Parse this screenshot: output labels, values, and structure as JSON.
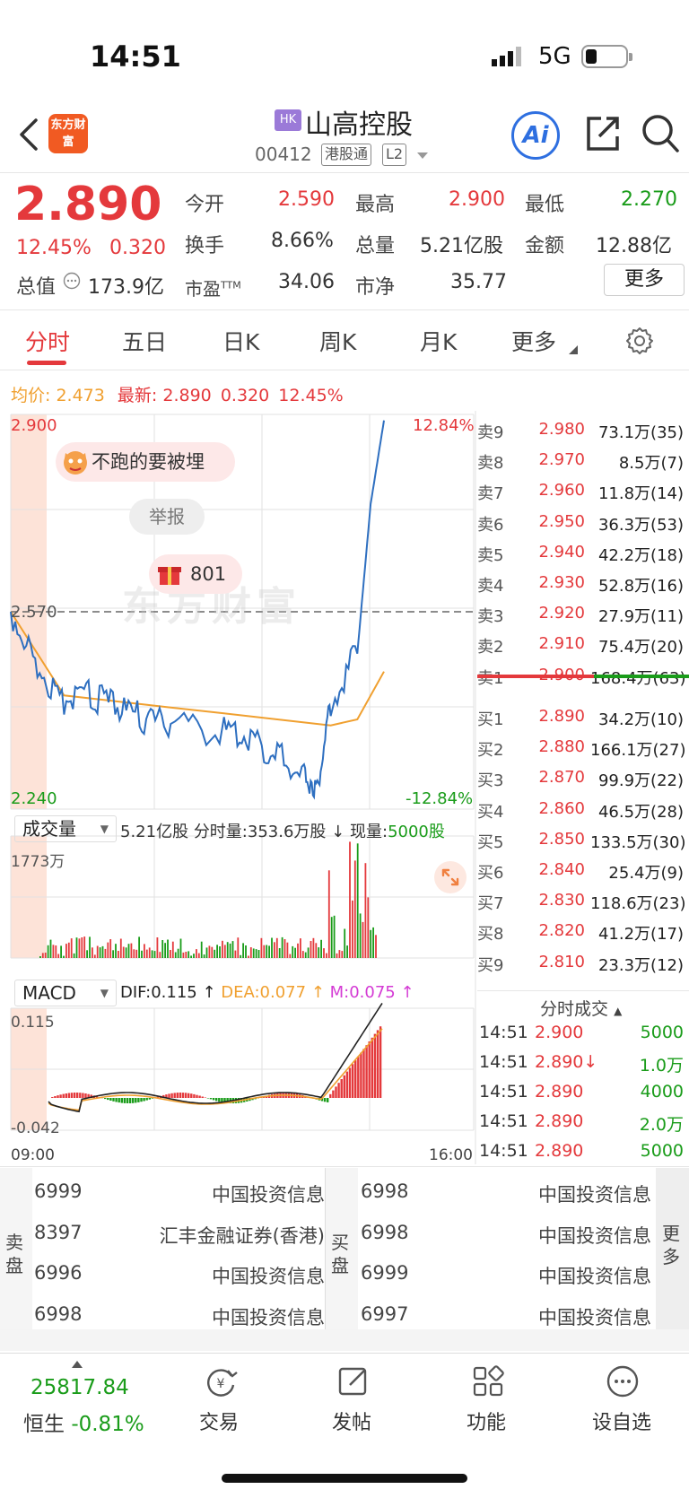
{
  "status": {
    "time": "14:51",
    "network": "5G"
  },
  "header": {
    "logo_text": "东方财富",
    "market_badge": "HK",
    "stock_name": "山高控股",
    "stock_code": "00412",
    "tag_connect": "港股通",
    "tag_level": "L2",
    "ai_label": "Ai"
  },
  "quote": {
    "price": "2.890",
    "change_pct": "12.45%",
    "change": "0.320",
    "open_label": "今开",
    "open": "2.590",
    "high_label": "最高",
    "high": "2.900",
    "low_label": "最低",
    "low": "2.270",
    "turnover_label": "换手",
    "turnover": "8.66%",
    "volume_label": "总量",
    "volume": "5.21亿股",
    "amount_label": "金额",
    "amount": "12.88亿",
    "mktcap_label": "总值",
    "mktcap": "173.9亿",
    "pe_label": "市盈",
    "pe_sup": "TTM",
    "pe": "34.06",
    "pb_label": "市净",
    "pb": "35.77",
    "more_button": "更多"
  },
  "tabs": [
    "分时",
    "五日",
    "日K",
    "周K",
    "月K",
    "更多"
  ],
  "active_tab": 0,
  "intraday": {
    "avg_label": "均价:",
    "avg_value": "2.473",
    "latest_label": "最新:",
    "latest_value": "2.890",
    "latest_change": "0.320",
    "latest_pct": "12.45%",
    "y_top": "2.900",
    "y_mid": "2.570",
    "y_bottom": "2.240",
    "pct_top": "12.84%",
    "pct_bottom": "-12.84%",
    "banner_text": "不跑的要被埋",
    "report_label": "举报",
    "gift_count": "801",
    "watermark": "东方财富"
  },
  "volume_panel": {
    "selector": "成交量",
    "total": "5.21亿股",
    "period_label": "分时量:",
    "period_value": "353.6万股",
    "now_label": "现量:",
    "now_value": "5000股",
    "max_label": "1773万"
  },
  "macd_panel": {
    "selector": "MACD",
    "dif": "DIF:0.115",
    "dea": "DEA:0.077",
    "m": "M:0.075",
    "y_top": "0.115",
    "y_bottom": "-0.042",
    "x_start": "09:00",
    "x_end": "16:00"
  },
  "chart_data": {
    "type": "line",
    "series": [
      {
        "name": "最新",
        "x": [
          "09:00",
          "09:30",
          "10:00",
          "10:30",
          "11:00",
          "11:30",
          "12:00",
          "13:00",
          "13:30",
          "14:00",
          "14:30",
          "14:45",
          "15:00",
          "15:30",
          "15:45",
          "16:00"
        ],
        "values": [
          2.57,
          2.48,
          2.42,
          2.43,
          2.41,
          2.39,
          2.38,
          2.37,
          2.36,
          2.33,
          2.3,
          2.28,
          2.42,
          2.5,
          2.75,
          2.89
        ]
      },
      {
        "name": "均价",
        "x": [
          "09:00",
          "10:00",
          "11:00",
          "12:00",
          "13:00",
          "14:00",
          "15:00",
          "15:30",
          "16:00"
        ],
        "values": [
          2.57,
          2.43,
          2.42,
          2.41,
          2.4,
          2.39,
          2.38,
          2.39,
          2.47
        ]
      }
    ],
    "ylim": [
      2.24,
      2.9
    ]
  },
  "orderbook": {
    "asks": [
      {
        "label": "卖9",
        "price": "2.980",
        "vol": "73.1万",
        "cnt": "(35)"
      },
      {
        "label": "卖8",
        "price": "2.970",
        "vol": "8.5万",
        "cnt": "(7)"
      },
      {
        "label": "卖7",
        "price": "2.960",
        "vol": "11.8万",
        "cnt": "(14)"
      },
      {
        "label": "卖6",
        "price": "2.950",
        "vol": "36.3万",
        "cnt": "(53)"
      },
      {
        "label": "卖5",
        "price": "2.940",
        "vol": "42.2万",
        "cnt": "(18)"
      },
      {
        "label": "卖4",
        "price": "2.930",
        "vol": "52.8万",
        "cnt": "(16)"
      },
      {
        "label": "卖3",
        "price": "2.920",
        "vol": "27.9万",
        "cnt": "(11)"
      },
      {
        "label": "卖2",
        "price": "2.910",
        "vol": "75.4万",
        "cnt": "(20)"
      },
      {
        "label": "卖1",
        "price": "2.900",
        "vol": "168.4万",
        "cnt": "(63)"
      }
    ],
    "bids": [
      {
        "label": "买1",
        "price": "2.890",
        "vol": "34.2万",
        "cnt": "(10)"
      },
      {
        "label": "买2",
        "price": "2.880",
        "vol": "166.1万",
        "cnt": "(27)"
      },
      {
        "label": "买3",
        "price": "2.870",
        "vol": "99.9万",
        "cnt": "(22)"
      },
      {
        "label": "买4",
        "price": "2.860",
        "vol": "46.5万",
        "cnt": "(28)"
      },
      {
        "label": "买5",
        "price": "2.850",
        "vol": "133.5万",
        "cnt": "(30)"
      },
      {
        "label": "买6",
        "price": "2.840",
        "vol": "25.4万",
        "cnt": "(9)"
      },
      {
        "label": "买7",
        "price": "2.830",
        "vol": "118.6万",
        "cnt": "(23)"
      },
      {
        "label": "买8",
        "price": "2.820",
        "vol": "41.2万",
        "cnt": "(17)"
      },
      {
        "label": "买9",
        "price": "2.810",
        "vol": "23.3万",
        "cnt": "(12)"
      }
    ],
    "ticks_title": "分时成交",
    "ticks": [
      {
        "time": "14:51",
        "price": "2.900",
        "vol": "5000"
      },
      {
        "time": "14:51",
        "price": "2.890↓",
        "vol": "1.0万"
      },
      {
        "time": "14:51",
        "price": "2.890",
        "vol": "4000"
      },
      {
        "time": "14:51",
        "price": "2.890",
        "vol": "2.0万"
      },
      {
        "time": "14:51",
        "price": "2.890",
        "vol": "5000"
      }
    ]
  },
  "brokers": {
    "sell_label": "卖盘",
    "buy_label": "买盘",
    "more_label": "更多",
    "sell": [
      {
        "code": "6999",
        "name": "中国投资信息"
      },
      {
        "code": "8397",
        "name": "汇丰金融证券(香港)"
      },
      {
        "code": "6996",
        "name": "中国投资信息"
      },
      {
        "code": "6998",
        "name": "中国投资信息"
      }
    ],
    "buy": [
      {
        "code": "6998",
        "name": "中国投资信息"
      },
      {
        "code": "6998",
        "name": "中国投资信息"
      },
      {
        "code": "6999",
        "name": "中国投资信息"
      },
      {
        "code": "6997",
        "name": "中国投资信息"
      }
    ]
  },
  "bottom_nav": {
    "index_value": "25817.84",
    "index_name": "恒生",
    "index_change": "-0.81%",
    "items": [
      "交易",
      "发帖",
      "功能",
      "设自选"
    ]
  },
  "colors": {
    "up": "#e4393c",
    "down": "#1a9c1a",
    "avg": "#f0a030",
    "price_line": "#2e6fc0"
  }
}
